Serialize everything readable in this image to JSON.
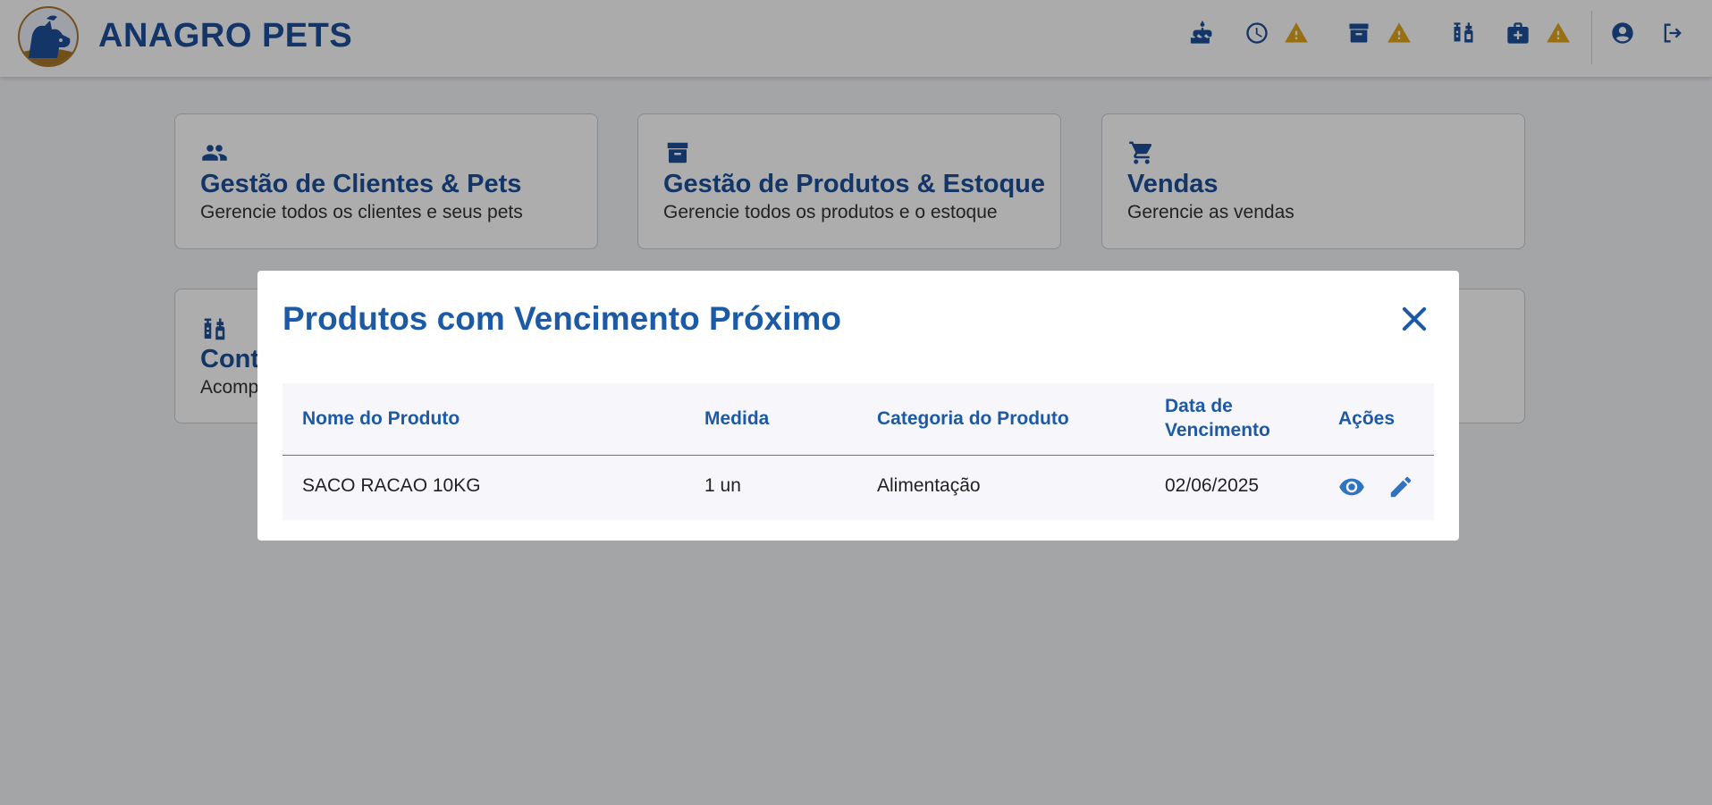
{
  "header": {
    "brand": "ANAGRO PETS",
    "icons": [
      "cake-icon",
      "clock-icon",
      "warning-icon",
      "archive-icon",
      "warning-icon",
      "vaccine-icon",
      "medical-kit-icon",
      "warning-icon",
      "account-icon",
      "logout-icon"
    ]
  },
  "cards": [
    {
      "icon": "people-icon",
      "title": "Gestão de Clientes & Pets",
      "desc": "Gerencie todos os clientes e seus pets"
    },
    {
      "icon": "archive-icon",
      "title": "Gestão de Produtos & Estoque",
      "desc": "Gerencie todos os produtos e o estoque"
    },
    {
      "icon": "cart-icon",
      "title": "Vendas",
      "desc": "Gerencie as vendas"
    },
    {
      "icon": "vaccine-icon",
      "title": "Cont",
      "desc": "Acomp"
    }
  ],
  "modal": {
    "title": "Produtos com Vencimento Próximo",
    "columns": {
      "name": "Nome do Produto",
      "measure": "Medida",
      "category": "Categoria do Produto",
      "expiry_line1": "Data de",
      "expiry_line2": "Vencimento",
      "actions": "Ações"
    },
    "rows": [
      {
        "name": "SACO RACAO 10KG",
        "measure": "1 un",
        "category": "Alimentação",
        "expiry": "02/06/2025"
      }
    ]
  },
  "colors": {
    "primary": "#1d4e98",
    "modal_title": "#1d5aa6",
    "warning": "#e0a41a",
    "action": "#2f74c0"
  }
}
